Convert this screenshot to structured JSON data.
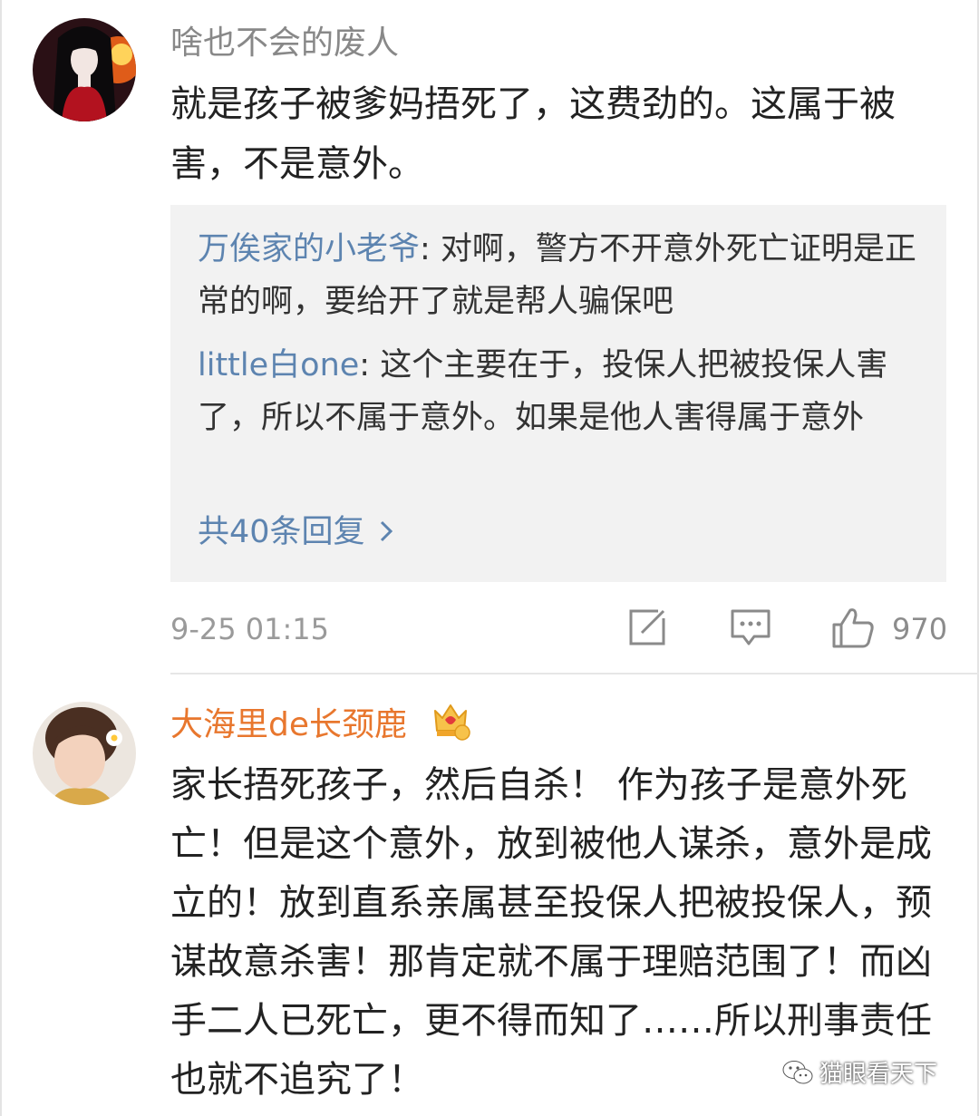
{
  "comments": [
    {
      "username": "啥也不会的废人",
      "text": "就是孩子被爹妈捂死了，这费劲的。这属于被害，不是意外。",
      "replies": [
        {
          "name": "万俟家的小老爷",
          "text": ": 对啊，警方不开意外死亡证明是正常的啊，要给开了就是帮人骗保吧"
        },
        {
          "name": "little白one",
          "text": ": 这个主要在于，投保人把被投保人害了，所以不属于意外。如果是他人害得属于意外"
        }
      ],
      "more_replies": "共40条回复",
      "time": "9-25 01:15",
      "like_count": "970"
    },
    {
      "username": "大海里de长颈鹿",
      "text": "家长捂死孩子，然后自杀！ 作为孩子是意外死亡！但是这个意外，放到被他人谋杀，意外是成立的！放到直系亲属甚至投保人把被投保人，预谋故意杀害！那肯定就不属于理赔范围了！而凶手二人已死亡，更不得而知了……所以刑事责任也就不追究了！"
    }
  ],
  "watermark": "猫眼看天下",
  "colors": {
    "username_gray": "#888888",
    "username_orange": "#e8772e",
    "reply_name_blue": "#5d84b0",
    "reply_background": "#f2f2f2"
  },
  "icons": [
    "share-edit-icon",
    "comment-icon",
    "thumbs-up-icon",
    "chevron-right-icon",
    "vip-crown-badge",
    "wechat-watermark-icon"
  ]
}
